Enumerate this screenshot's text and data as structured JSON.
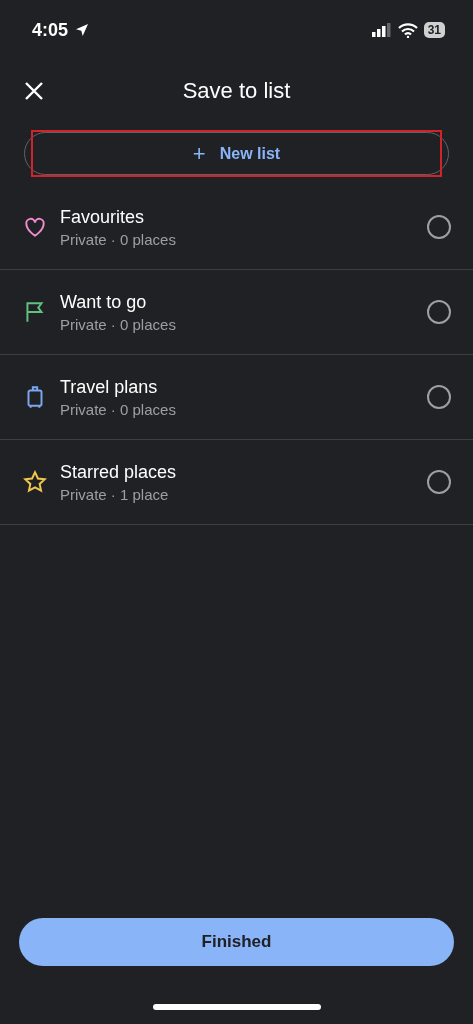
{
  "status_bar": {
    "time": "4:05",
    "battery": "31"
  },
  "header": {
    "title": "Save to list"
  },
  "new_list_button": {
    "icon": "+",
    "label": "New list",
    "highlighted": true
  },
  "lists": [
    {
      "kind": "heart",
      "color": "#f28bd0",
      "name": "Favourites",
      "detail": "Private · 0 places",
      "selected": false
    },
    {
      "kind": "flag",
      "color": "#5fc27e",
      "name": "Want to go",
      "detail": "Private · 0 places",
      "selected": false
    },
    {
      "kind": "suitcase",
      "color": "#7aa7ef",
      "name": "Travel plans",
      "detail": "Private · 0 places",
      "selected": false
    },
    {
      "kind": "star",
      "color": "#f1c84b",
      "name": "Starred places",
      "detail": "Private · 1 place",
      "selected": false
    }
  ],
  "finish_button": {
    "label": "Finished"
  }
}
